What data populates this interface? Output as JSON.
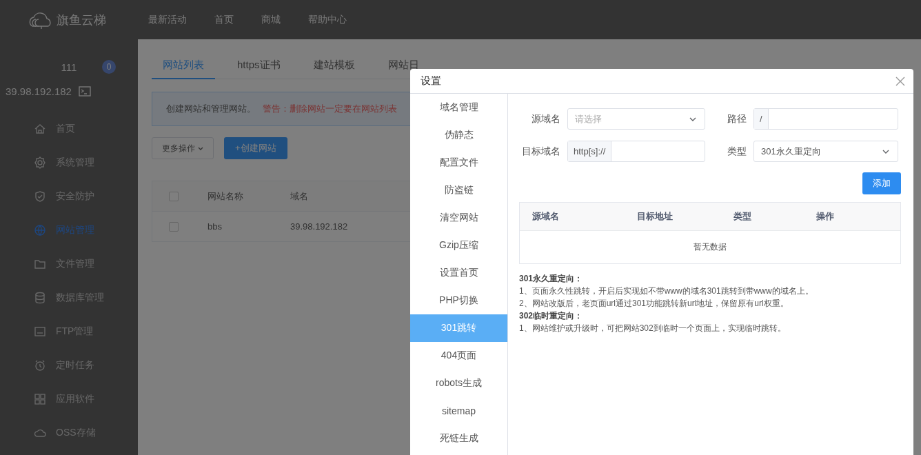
{
  "header": {
    "logo": "旗鱼云梯",
    "nav": [
      "最新活动",
      "首页",
      "商城",
      "帮助中心"
    ]
  },
  "sidebar": {
    "user": "111",
    "badge": "0",
    "ip": "39.98.192.182",
    "items": [
      {
        "label": "首页",
        "selected": false
      },
      {
        "label": "系统管理",
        "selected": false
      },
      {
        "label": "安全防护",
        "selected": false
      },
      {
        "label": "网站管理",
        "selected": true
      },
      {
        "label": "文件管理",
        "selected": false
      },
      {
        "label": "数据库管理",
        "selected": false
      },
      {
        "label": "FTP管理",
        "selected": false
      },
      {
        "label": "定时任务",
        "selected": false
      },
      {
        "label": "应用软件",
        "selected": false
      },
      {
        "label": "OSS存储",
        "selected": false
      }
    ]
  },
  "main": {
    "tabs": [
      {
        "label": "网站列表",
        "selected": true
      },
      {
        "label": "https证书",
        "selected": false
      },
      {
        "label": "建站模板",
        "selected": false
      },
      {
        "label": "网站日",
        "selected": false
      }
    ],
    "notice": {
      "text": "创建网站和管理网站。",
      "warning": "警告：删除网站一定要在网站列表"
    },
    "more_button": "更多操作",
    "create_button": "+创建网站",
    "table": {
      "columns": [
        "网站名称",
        "域名"
      ],
      "header_checked": false,
      "rows": [
        {
          "checked": false,
          "cells": [
            "bbs",
            "39.98.192.182"
          ]
        }
      ]
    }
  },
  "dialog": {
    "title": "设置",
    "nav": [
      {
        "label": "域名管理",
        "selected": false
      },
      {
        "label": "伪静态",
        "selected": false
      },
      {
        "label": "配置文件",
        "selected": false
      },
      {
        "label": "防盗链",
        "selected": false
      },
      {
        "label": "清空网站",
        "selected": false
      },
      {
        "label": "Gzip压缩",
        "selected": false
      },
      {
        "label": "设置首页",
        "selected": false
      },
      {
        "label": "PHP切换",
        "selected": false
      },
      {
        "label": "301跳转",
        "selected": true
      },
      {
        "label": "404页面",
        "selected": false
      },
      {
        "label": "robots生成",
        "selected": false
      },
      {
        "label": "sitemap",
        "selected": false
      },
      {
        "label": "死链生成",
        "selected": false
      }
    ],
    "form": {
      "source": {
        "label": "源域名",
        "placeholder": "请选择"
      },
      "path": {
        "label": "路径",
        "prefix": "/"
      },
      "target": {
        "label": "目标域名",
        "prefix": "http[s]://"
      },
      "type": {
        "label": "类型",
        "value": "301永久重定向"
      }
    },
    "add_button": "添加",
    "table": {
      "columns": [
        "源域名",
        "目标地址",
        "类型",
        "操作"
      ],
      "empty": "暂无数据"
    },
    "notes": [
      {
        "kind": "heading",
        "text": "301永久重定向："
      },
      {
        "kind": "line",
        "text": "1、页面永久性跳转，开启后实现如不带www的域名301跳转到带www的域名上。"
      },
      {
        "kind": "line",
        "text": "2、网站改版后，老页面url通过301功能跳转新url地址，保留原有url权重。"
      },
      {
        "kind": "heading",
        "text": "302临时重定向："
      },
      {
        "kind": "line",
        "text": "1、网站维护或升级时，可把网站302到临时一个页面上，实现临时跳转。"
      }
    ]
  }
}
